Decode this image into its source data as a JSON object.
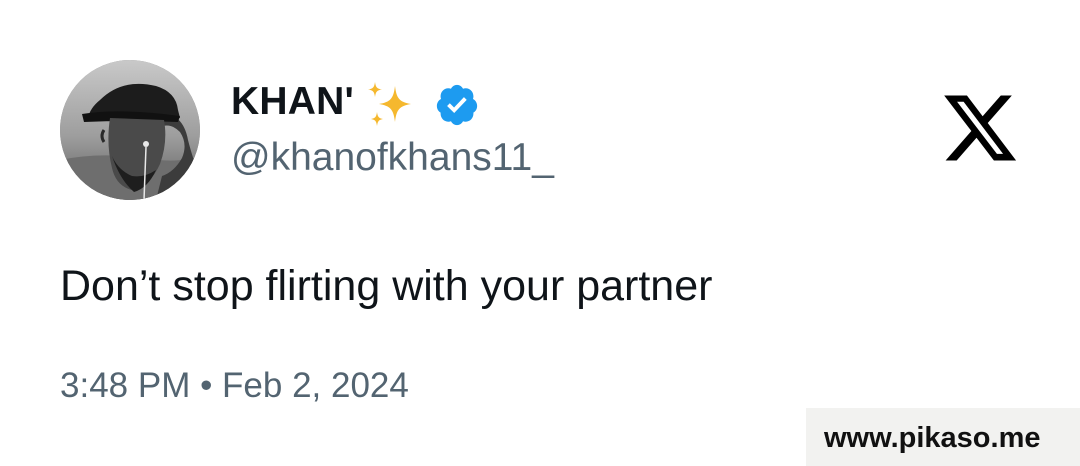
{
  "author": {
    "display_name": "KHAN'",
    "handle": "@khanofkhans11_",
    "verified": true,
    "name_emoji": "sparkles-icon",
    "avatar": "avatar-photo-grayscale"
  },
  "tweet": {
    "text": "Don’t stop flirting with your partner",
    "timestamp": "3:48 PM • Feb 2, 2024"
  },
  "platform": {
    "logo": "x-logo-icon"
  },
  "watermark": {
    "text": "www.pikaso.me"
  },
  "colors": {
    "text_primary": "#0f1419",
    "text_secondary": "#536471",
    "verified_blue": "#1d9bf0",
    "sparkle_gold": "#f5b82e",
    "background": "#ffffff",
    "watermark_bg": "#f2f2f0"
  }
}
